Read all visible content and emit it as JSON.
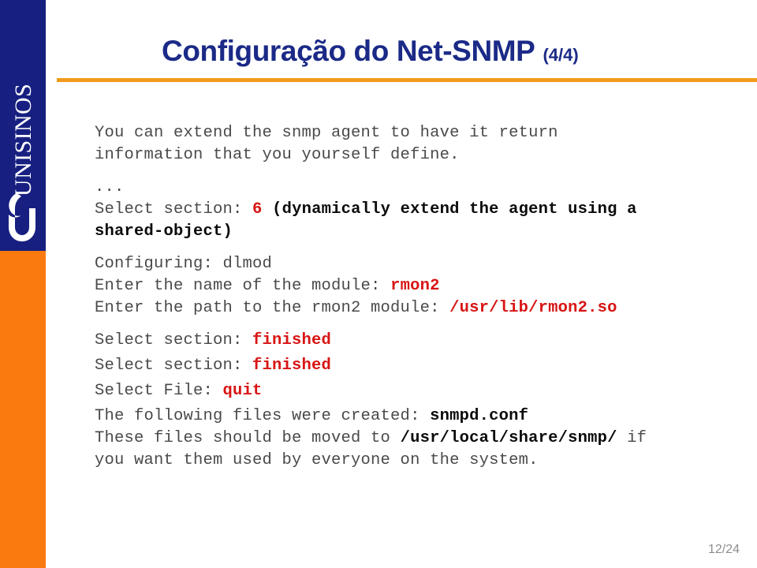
{
  "slide": {
    "title_main": "Configuração do Net-SNMP",
    "title_sub": "(4/4)",
    "page_number": "12/24",
    "brand": {
      "name": "UNISINOS",
      "logo_mark": "unisinos-swoosh-icon",
      "bar_blue": "#172080",
      "bar_orange": "#fb7a10",
      "rule_color": "#f29b1d",
      "title_color": "#1b2a87"
    },
    "terminal": {
      "accent_red": "#d81414",
      "accent_black": "#0b0b0b",
      "base_color": "#4a4a4a",
      "blocks": [
        {
          "id": "intro",
          "lines": [
            [
              {
                "t": "You can extend the snmp agent to have it return",
                "s": "base"
              }
            ],
            [
              {
                "t": "information that you yourself define.",
                "s": "base"
              }
            ]
          ]
        },
        {
          "id": "ellipsis-and-select-6",
          "lines": [
            [
              {
                "t": "...",
                "s": "base"
              }
            ],
            [
              {
                "t": "Select section: ",
                "s": "base"
              },
              {
                "t": "6",
                "s": "red"
              },
              {
                "t": " ",
                "s": "base"
              },
              {
                "t": "(dynamically extend the agent using a",
                "s": "black"
              }
            ],
            [
              {
                "t": "shared-object)",
                "s": "black"
              }
            ]
          ]
        },
        {
          "id": "dlmod-config",
          "lines": [
            [
              {
                "t": "Configuring: dlmod",
                "s": "base"
              }
            ],
            [
              {
                "t": "Enter the name of the module: ",
                "s": "base"
              },
              {
                "t": "rmon2",
                "s": "red"
              }
            ],
            [
              {
                "t": "Enter the path to the rmon2 module: ",
                "s": "base"
              },
              {
                "t": "/usr/lib/rmon2.so",
                "s": "red"
              }
            ]
          ]
        },
        {
          "id": "finished-1",
          "lines": [
            [
              {
                "t": "Select section: ",
                "s": "base"
              },
              {
                "t": "finished",
                "s": "red"
              }
            ]
          ]
        },
        {
          "id": "finished-2",
          "lines": [
            [
              {
                "t": "Select section: ",
                "s": "base"
              },
              {
                "t": "finished",
                "s": "red"
              }
            ]
          ]
        },
        {
          "id": "select-file-quit",
          "lines": [
            [
              {
                "t": "Select File: ",
                "s": "base"
              },
              {
                "t": "quit",
                "s": "red"
              }
            ]
          ]
        },
        {
          "id": "created-files",
          "lines": [
            [
              {
                "t": "The following files were created: ",
                "s": "base"
              },
              {
                "t": "snmpd.conf",
                "s": "black"
              }
            ],
            [
              {
                "t": "These files should be moved to ",
                "s": "base"
              },
              {
                "t": "/usr/local/share/snmp/",
                "s": "black"
              },
              {
                "t": " if",
                "s": "base"
              }
            ],
            [
              {
                "t": "you want them used by everyone on the system.",
                "s": "base"
              }
            ]
          ]
        }
      ]
    }
  }
}
